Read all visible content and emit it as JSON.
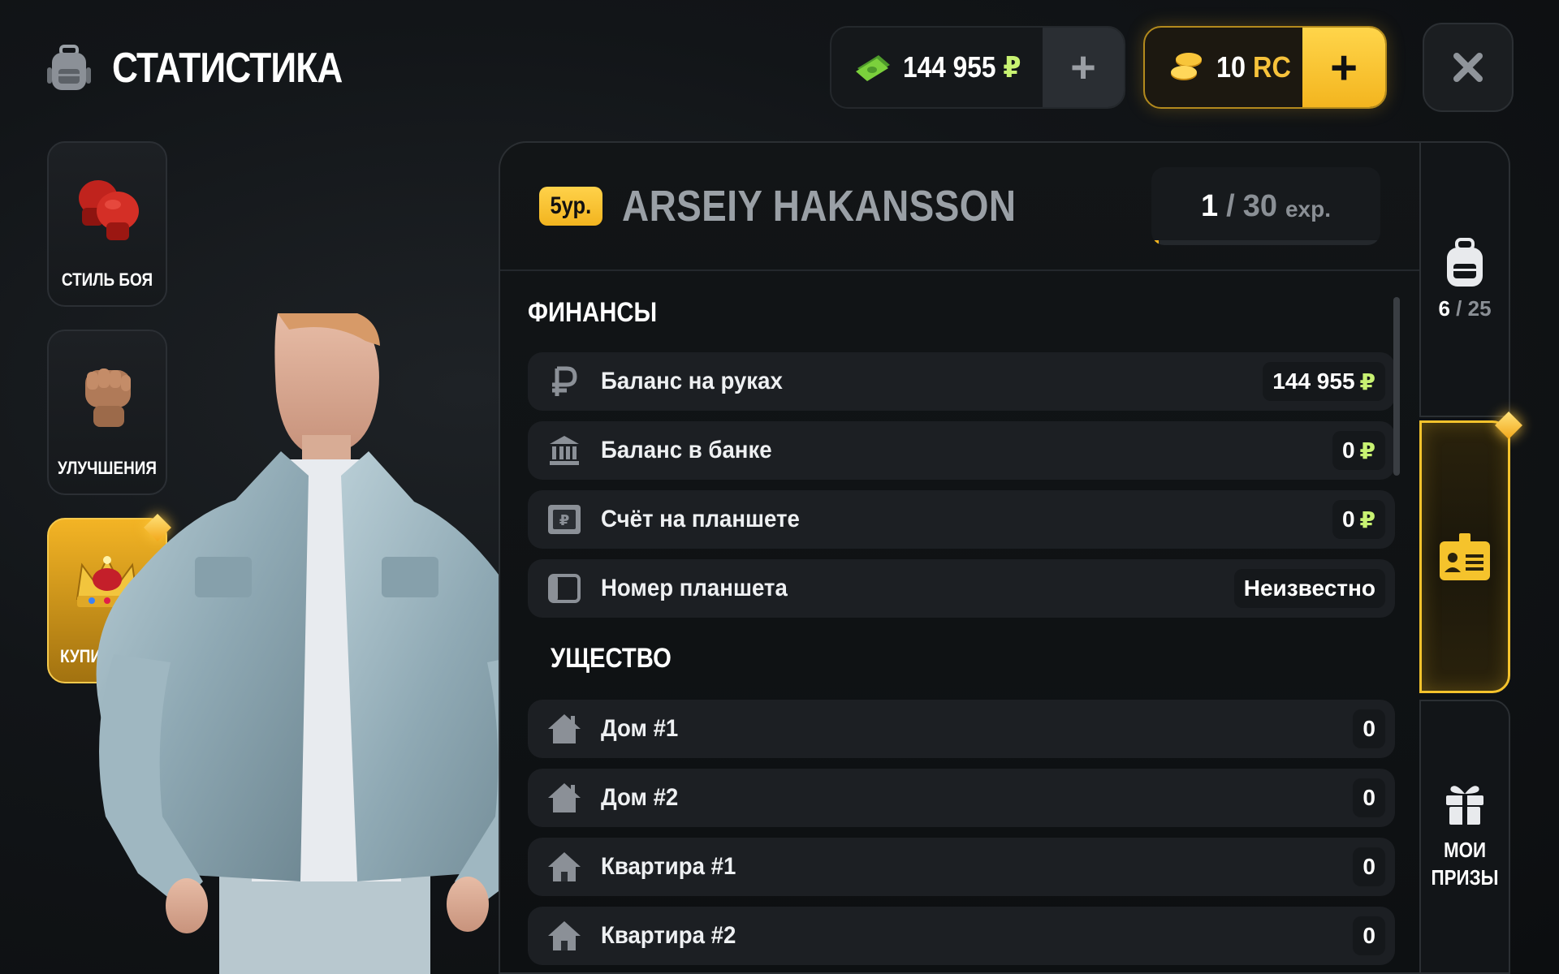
{
  "header": {
    "title": "СТАТИСТИКА",
    "money": {
      "amount": "144 955",
      "currency": "₽",
      "plus": "+"
    },
    "rc": {
      "amount": "10",
      "currency": "RC",
      "plus": "+"
    }
  },
  "left_tabs": [
    {
      "label": "СТИЛЬ БОЯ",
      "icon": "boxing-gloves-icon",
      "active": false
    },
    {
      "label": "УЛУЧШЕНИЯ",
      "icon": "fist-icon",
      "active": false
    },
    {
      "label": "КУПИ",
      "icon": "crown-icon",
      "active": true
    }
  ],
  "player": {
    "level_badge": "5ур.",
    "name": "ARSEIY HAKANSSON",
    "exp_current": "1",
    "exp_separator": "/",
    "exp_max": "30",
    "exp_unit": "exp.",
    "exp_progress": 0.033
  },
  "finance": {
    "title": "ФИНАНСЫ",
    "rows": [
      {
        "label": "Баланс на руках",
        "value": "144 955",
        "currency": "₽",
        "icon": "ruble-icon"
      },
      {
        "label": "Баланс в банке",
        "value": "0",
        "currency": "₽",
        "icon": "bank-icon"
      },
      {
        "label": "Счёт на планшете",
        "value": "0",
        "currency": "₽",
        "icon": "tablet-wallet-icon"
      },
      {
        "label": "Номер планшета",
        "value": "Неизвестно",
        "currency": "",
        "icon": "tablet-icon"
      }
    ]
  },
  "property": {
    "title": "УЩЕСТВО",
    "rows": [
      {
        "label": "Дом #1",
        "value": "0",
        "icon": "house-icon"
      },
      {
        "label": "Дом #2",
        "value": "0",
        "icon": "house-icon"
      },
      {
        "label": "Квартира #1",
        "value": "0",
        "icon": "apartment-icon"
      },
      {
        "label": "Квартира #2",
        "value": "0",
        "icon": "apartment-icon"
      }
    ]
  },
  "right_sidebar": {
    "inventory": {
      "current": "6",
      "separator": "/",
      "max": "25"
    },
    "stats_active": true,
    "prizes_label": "МОИ ПРИЗЫ"
  },
  "colors": {
    "accent_gold": "#f5c32c",
    "ruble_green": "#c8f272",
    "panel_bg": "#121517"
  }
}
